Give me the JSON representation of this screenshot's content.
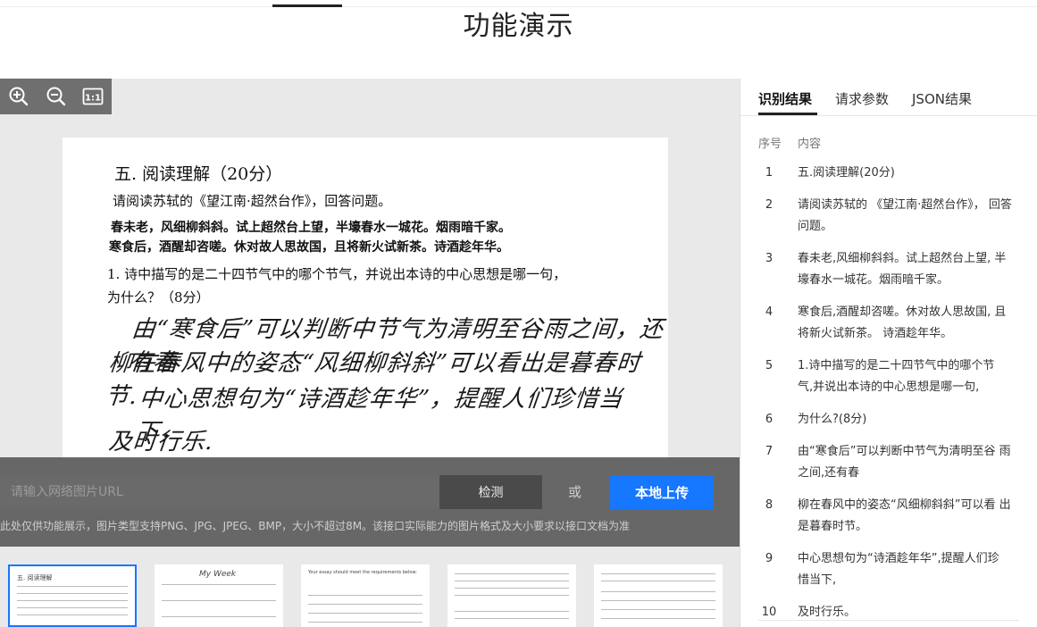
{
  "page": {
    "title": "功能演示"
  },
  "zoom_toolbar": {
    "icons": [
      "zoom-in-icon",
      "zoom-out-icon",
      "actual-size-icon"
    ],
    "actual_size_label": "1:1"
  },
  "document": {
    "heading": "五. 阅读理解（20分）",
    "line1": "请阅读苏轼的《望江南·超然台作》，回答问题。",
    "line2": "春未老，风细柳斜斜。试上超然台上望，半壕春水一城花。烟雨暗千家。",
    "line3": "寒食后，酒醒却咨嗟。休对故人思故国，且将新火试新茶。诗酒趁年华。",
    "line4": "1. 诗中描写的是二十四节气中的哪个节气，并说出本诗的中心思想是哪一句，",
    "line5": "为什么？（8分）",
    "hw1": "由“寒食后”可以判断中节气为清明至谷雨之间，还有春",
    "hw2": "柳在春风中的姿态“风细柳斜斜”可以看出是暮春时节.",
    "hw3": "中心思想句为“诗酒趁年华”，提醒人们珍惜当下，",
    "hw4": "及时行乐."
  },
  "upload": {
    "url_placeholder": "请输入网络图片URL",
    "detect_label": "检测",
    "or_label": "或",
    "upload_label": "本地上传",
    "hint": "此处仅供功能展示，图片类型支持PNG、JPG、JPEG、BMP，大小不超过8M。该接口实际能力的图片格式及大小要求以接口文档为准"
  },
  "thumbnails": [
    {
      "caption": "五. 阅读理解",
      "active": true
    },
    {
      "caption": "My Week",
      "active": false
    },
    {
      "caption": "Your essay should meet the requirements below:",
      "active": false
    },
    {
      "caption": "",
      "active": false
    },
    {
      "caption": "",
      "active": false
    }
  ],
  "panel": {
    "tabs": [
      "识别结果",
      "请求参数",
      "JSON结果"
    ],
    "active_tab": "识别结果",
    "col_index": "序号",
    "col_content": "内容",
    "rows": [
      {
        "index": "1",
        "text": "五.阅读理解(20分)"
      },
      {
        "index": "2",
        "text": "请阅读苏轼的 《望江南·超然台作》， 回答问题。"
      },
      {
        "index": "3",
        "text": "春未老,风细柳斜斜。试上超然台上望, 半壕春水一城花。烟雨暗千家。"
      },
      {
        "index": "4",
        "text": "寒食后,酒醒却咨嗟。休对故人思故国, 且将新火试新茶。 诗酒趁年华。"
      },
      {
        "index": "5",
        "text": "1.诗中描写的是二十四节气中的哪个节 气,并说出本诗的中心思想是哪一句,"
      },
      {
        "index": "6",
        "text": "为什么?(8分)"
      },
      {
        "index": "7",
        "text": "由“寒食后”可以判断中节气为清明至谷 雨之间,还有春"
      },
      {
        "index": "8",
        "text": "柳在春风中的姿态“风细柳斜斜”可以看 出是暮春时节。"
      },
      {
        "index": "9",
        "text": "中心思想句为“诗酒趁年华”,提醒人们珍 惜当下,"
      },
      {
        "index": "10",
        "text": "及时行乐。"
      }
    ]
  },
  "colors": {
    "accent": "#1677ff",
    "toolbar": "#6f6f6f",
    "viewer_bg": "#e9e9e9"
  }
}
